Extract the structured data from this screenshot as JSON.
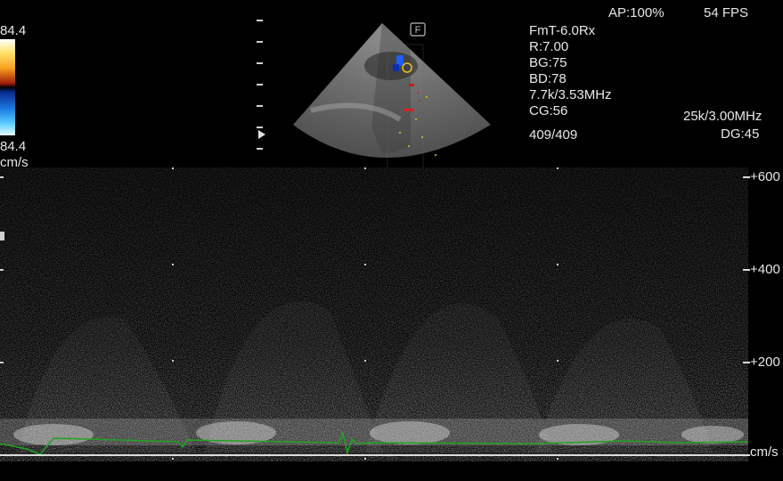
{
  "header": {
    "ap": "AP:100%",
    "fps": "54 FPS"
  },
  "color_scale": {
    "top_value": "84.4",
    "bottom_value": "84.4",
    "unit": "cm/s"
  },
  "params": {
    "probe": "FmT-6.0Rx",
    "r": "R:7.00",
    "bg": "BG:75",
    "bd": "BD:78",
    "freq": "7.7k/3.53MHz",
    "cg": "CG:56",
    "frame": "409/409"
  },
  "doppler_params": {
    "prf": "25k/3.00MHz",
    "dg": "DG:45"
  },
  "sector": {
    "focus_marker": "F"
  },
  "velocity_scale": {
    "labels": [
      "+600",
      "+400",
      "+200"
    ],
    "unit": "cm/s"
  },
  "colors": {
    "ecg_trace": "#1fa51f",
    "baseline": "#dcdcdc",
    "background": "#000000"
  }
}
